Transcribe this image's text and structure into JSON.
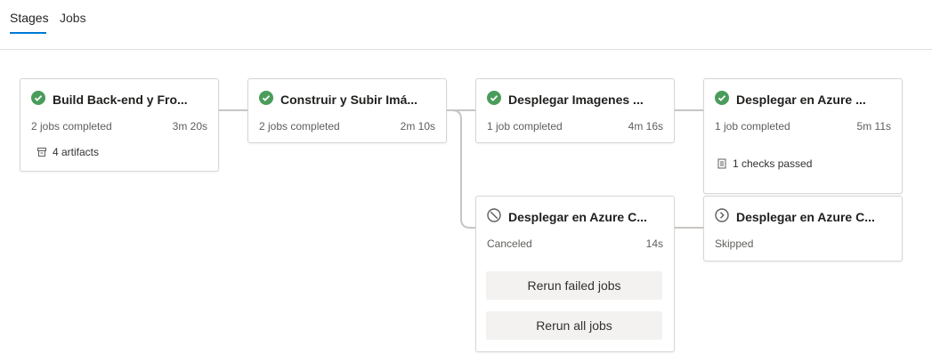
{
  "tabs": [
    {
      "label": "Stages",
      "active": true
    },
    {
      "label": "Jobs",
      "active": false
    }
  ],
  "stages": [
    {
      "title": "Build Back-end y Fro...",
      "status": "succeeded",
      "status_icon": "check-circle-icon",
      "meta": "2 jobs completed",
      "duration": "3m 20s",
      "extra": "4 artifacts",
      "extra_icon": "artifact-icon"
    },
    {
      "title": "Construir y Subir Imá...",
      "status": "succeeded",
      "status_icon": "check-circle-icon",
      "meta": "2 jobs completed",
      "duration": "2m 10s"
    },
    {
      "title": "Desplegar Imagenes ...",
      "status": "succeeded",
      "status_icon": "check-circle-icon",
      "meta": "1 job completed",
      "duration": "4m 16s"
    },
    {
      "title": "Desplegar en Azure ...",
      "status": "succeeded",
      "status_icon": "check-circle-icon",
      "meta": "1 job completed",
      "duration": "5m 11s",
      "extra": "1 checks passed",
      "extra_icon": "checklist-icon"
    },
    {
      "title": "Desplegar en Azure C...",
      "status": "canceled",
      "status_icon": "canceled-icon",
      "meta": "Canceled",
      "duration": "14s",
      "actions": {
        "rerun_failed": "Rerun failed jobs",
        "rerun_all": "Rerun all jobs"
      }
    },
    {
      "title": "Desplegar en Azure C...",
      "status": "skipped",
      "status_icon": "skipped-icon",
      "meta": "Skipped",
      "duration": ""
    }
  ],
  "colors": {
    "success": "#4a9c5a",
    "accent": "#0078d4",
    "neutral": "#605e5c",
    "connector": "#c8c6c4"
  }
}
